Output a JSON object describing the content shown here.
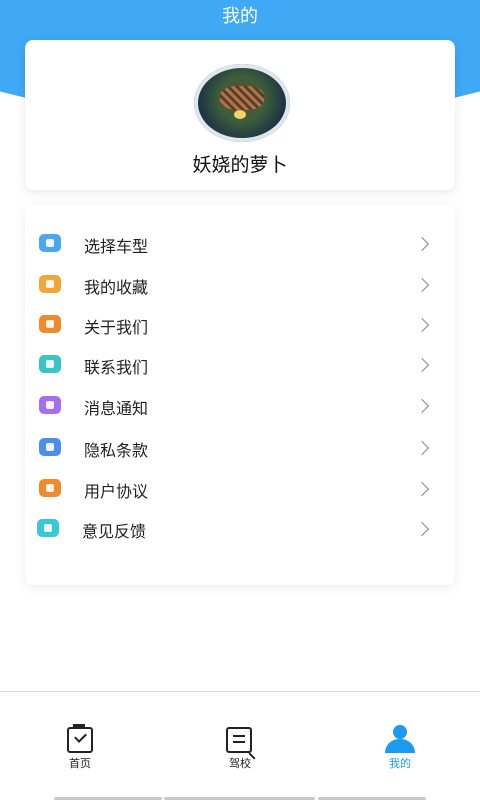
{
  "header": {
    "title": "我的"
  },
  "profile": {
    "username": "妖娆的萝卜"
  },
  "menu": {
    "items": [
      {
        "label": "选择车型",
        "icon": "car-icon",
        "color": "#4aa7f1"
      },
      {
        "label": "我的收藏",
        "icon": "bookmark-icon",
        "color": "#f1a63a"
      },
      {
        "label": "关于我们",
        "icon": "info-icon",
        "color": "#f08b2b"
      },
      {
        "label": "联系我们",
        "icon": "phone-icon",
        "color": "#39c5c6"
      },
      {
        "label": "消息通知",
        "icon": "message-icon",
        "color": "#a46ef0"
      },
      {
        "label": "隐私条款",
        "icon": "shield-icon",
        "color": "#4d8fe8"
      },
      {
        "label": "用户协议",
        "icon": "id-card-icon",
        "color": "#f08b2b"
      },
      {
        "label": "意见反馈",
        "icon": "mail-icon",
        "color": "#3ac7d8"
      }
    ]
  },
  "bottom_nav": {
    "items": [
      {
        "label": "首页",
        "icon": "home-icon",
        "active": false
      },
      {
        "label": "驾校",
        "icon": "school-icon",
        "active": false
      },
      {
        "label": "我的",
        "icon": "user-icon",
        "active": true
      }
    ],
    "active_color": "#1a9bf0"
  },
  "colors": {
    "header_blue": "#3fa9f5"
  }
}
